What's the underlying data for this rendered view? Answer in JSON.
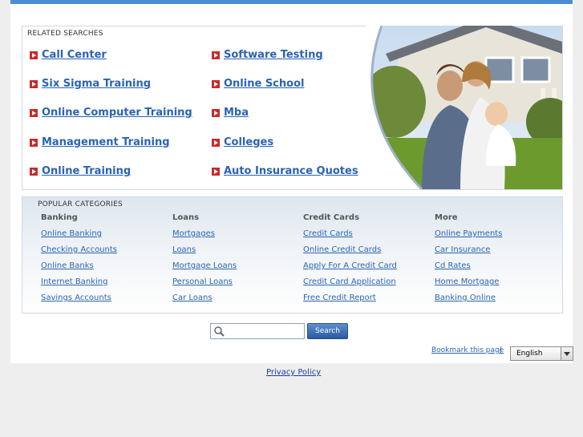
{
  "related": {
    "title": "RELATED SEARCHES",
    "left": [
      "Call Center",
      "Six Sigma Training",
      "Online Computer Training",
      "Management Training",
      "Online Training"
    ],
    "right": [
      "Software Testing",
      "Online School",
      "Mba",
      "Colleges",
      "Auto Insurance Quotes"
    ]
  },
  "popular": {
    "title": "POPULAR CATEGORIES",
    "columns": [
      {
        "head": "Banking",
        "links": [
          "Online Banking",
          "Checking Accounts",
          "Online Banks",
          "Internet Banking",
          "Savings Accounts"
        ]
      },
      {
        "head": "Loans",
        "links": [
          "Mortgages",
          "Loans",
          "Mortgage Loans",
          "Personal Loans",
          "Car Loans"
        ]
      },
      {
        "head": "Credit Cards",
        "links": [
          "Credit Cards",
          "Online Credit Cards",
          "Apply For A Credit Card",
          "Credit Card Application",
          "Free Credit Report"
        ]
      },
      {
        "head": "More",
        "links": [
          "Online Payments",
          "Car Insurance",
          "Cd Rates",
          "Home Mortgage",
          "Banking Online"
        ]
      }
    ]
  },
  "search": {
    "button_label": "Search",
    "value": ""
  },
  "footer": {
    "bookmark": "Bookmark this page",
    "separator": "|",
    "language": "English",
    "privacy": "Privacy Policy"
  }
}
